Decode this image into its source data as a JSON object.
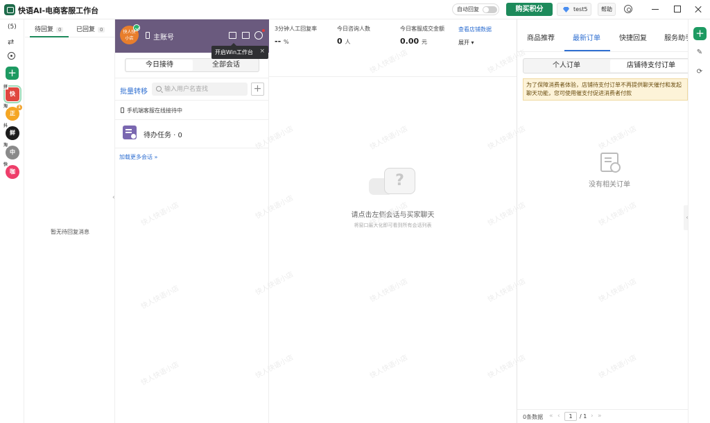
{
  "app": {
    "title": "快语AI-电商客服工作台",
    "auto_reply_label": "自动回复",
    "auto_reply_on": false,
    "buy_points_label": "购买积分",
    "user_name": "test5",
    "help_label": "帮助"
  },
  "iconbar": {
    "count_label": "(5)",
    "shops": [
      {
        "mini": "拼",
        "text": "快",
        "color": "#e0463f",
        "selected": true
      },
      {
        "mini": "淘",
        "text": "正",
        "color": "#f5a623",
        "badge": "1"
      },
      {
        "mini": "抖",
        "text": "鲜",
        "color": "#1c1c1c"
      },
      {
        "mini": "淘",
        "text": "中",
        "color": "#8a8a8a"
      },
      {
        "mini": "快",
        "text": "咖",
        "color": "#ee3e6a"
      }
    ]
  },
  "pending": {
    "tab_waiting": "待回复",
    "tab_waiting_count": "0",
    "tab_replied": "已回复",
    "tab_replied_count": "0",
    "empty_text": "暂无待回复消息"
  },
  "sessions": {
    "avatar_line1": "快人快",
    "avatar_line2": "小店",
    "account_name": "主账号",
    "tooltip_text": "开启Win工作台",
    "tooltip_close": "×",
    "tab_today": "今日接待",
    "tab_all": "全部会话",
    "batch_transfer": "批量转移",
    "search_placeholder": "输入用户名查找",
    "search_value": "",
    "mobile_status": "手机端客服在线接待中",
    "todo_label": "待办任务 · 0",
    "load_more": "加载更多会话 »"
  },
  "stats": [
    {
      "label": "3分钟人工回复率",
      "value": "-- ",
      "unit": "%"
    },
    {
      "label": "今日咨询人数",
      "value": "0 ",
      "unit": "人"
    },
    {
      "label": "今日客服成交金额",
      "value": "0.00 ",
      "unit": "元"
    }
  ],
  "stats_link": "查看店铺数据",
  "stats_expand": "展开 ▾",
  "center": {
    "message": "请点击左侧会话与买家聊天",
    "sub": "将窗口最大化即可看到所有会话列表"
  },
  "right": {
    "tabs": [
      "商品推荐",
      "最新订单",
      "快捷回复",
      "服务助手"
    ],
    "active_tab": 1,
    "seg_personal": "个人订单",
    "seg_unpaid": "店铺待支付订单",
    "notice": "为了保障消费者体验，店铺待支付订单不再提供聊天催付和发起聊天功能，您可使用催支付促进消费者付款",
    "empty": "没有相关订单",
    "pager_count": "0条数据",
    "page_current": "1",
    "page_total": "/ 1"
  },
  "watermark_text": "快人快语小店"
}
